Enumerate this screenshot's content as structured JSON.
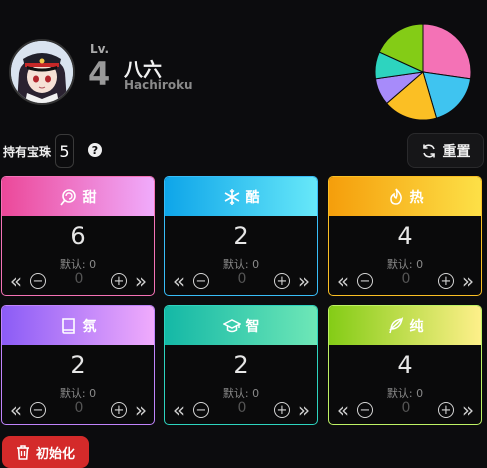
{
  "profile": {
    "level_label": "Lv.",
    "level": "4",
    "name": "八六",
    "name_romaji": "Hachiroku"
  },
  "pie": {
    "slices": [
      {
        "value": 6,
        "color": "#f472b6"
      },
      {
        "value": 4,
        "color": "#3fc4f0"
      },
      {
        "value": 4,
        "color": "#fbbf24"
      },
      {
        "value": 2,
        "color": "#a78bfa"
      },
      {
        "value": 2,
        "color": "#2dd4bf"
      },
      {
        "value": 4,
        "color": "#84cc16"
      }
    ]
  },
  "gems": {
    "label": "持有宝珠",
    "count": "5",
    "help": "?"
  },
  "reset_button": "重置",
  "cards": [
    {
      "label": "甜",
      "icon": "lollipop-icon",
      "value": "6",
      "default_text": "默认: 0",
      "input": "0",
      "grad_from": "#ec4899",
      "grad_to": "#f0abfc",
      "border": "#f472b6"
    },
    {
      "label": "酷",
      "icon": "snowflake-icon",
      "value": "2",
      "default_text": "默认: 0",
      "input": "0",
      "grad_from": "#0ea5e9",
      "grad_to": "#67e8f9",
      "border": "#38bdf8"
    },
    {
      "label": "热",
      "icon": "flame-icon",
      "value": "4",
      "default_text": "默认: 0",
      "input": "0",
      "grad_from": "#f59e0b",
      "grad_to": "#fde047",
      "border": "#fbbf24"
    },
    {
      "label": "氛",
      "icon": "book-icon",
      "value": "2",
      "default_text": "默认: 0",
      "input": "0",
      "grad_from": "#8b5cf6",
      "grad_to": "#f0abfc",
      "border": "#c084fc"
    },
    {
      "label": "智",
      "icon": "graduation-cap-icon",
      "value": "2",
      "default_text": "默认: 0",
      "input": "0",
      "grad_from": "#14b8a6",
      "grad_to": "#6ee7b7",
      "border": "#2dd4bf"
    },
    {
      "label": "纯",
      "icon": "feather-icon",
      "value": "4",
      "default_text": "默认: 0",
      "input": "0",
      "grad_from": "#84cc16",
      "grad_to": "#fef08a",
      "border": "#bef264"
    }
  ],
  "init_button": "初始化"
}
